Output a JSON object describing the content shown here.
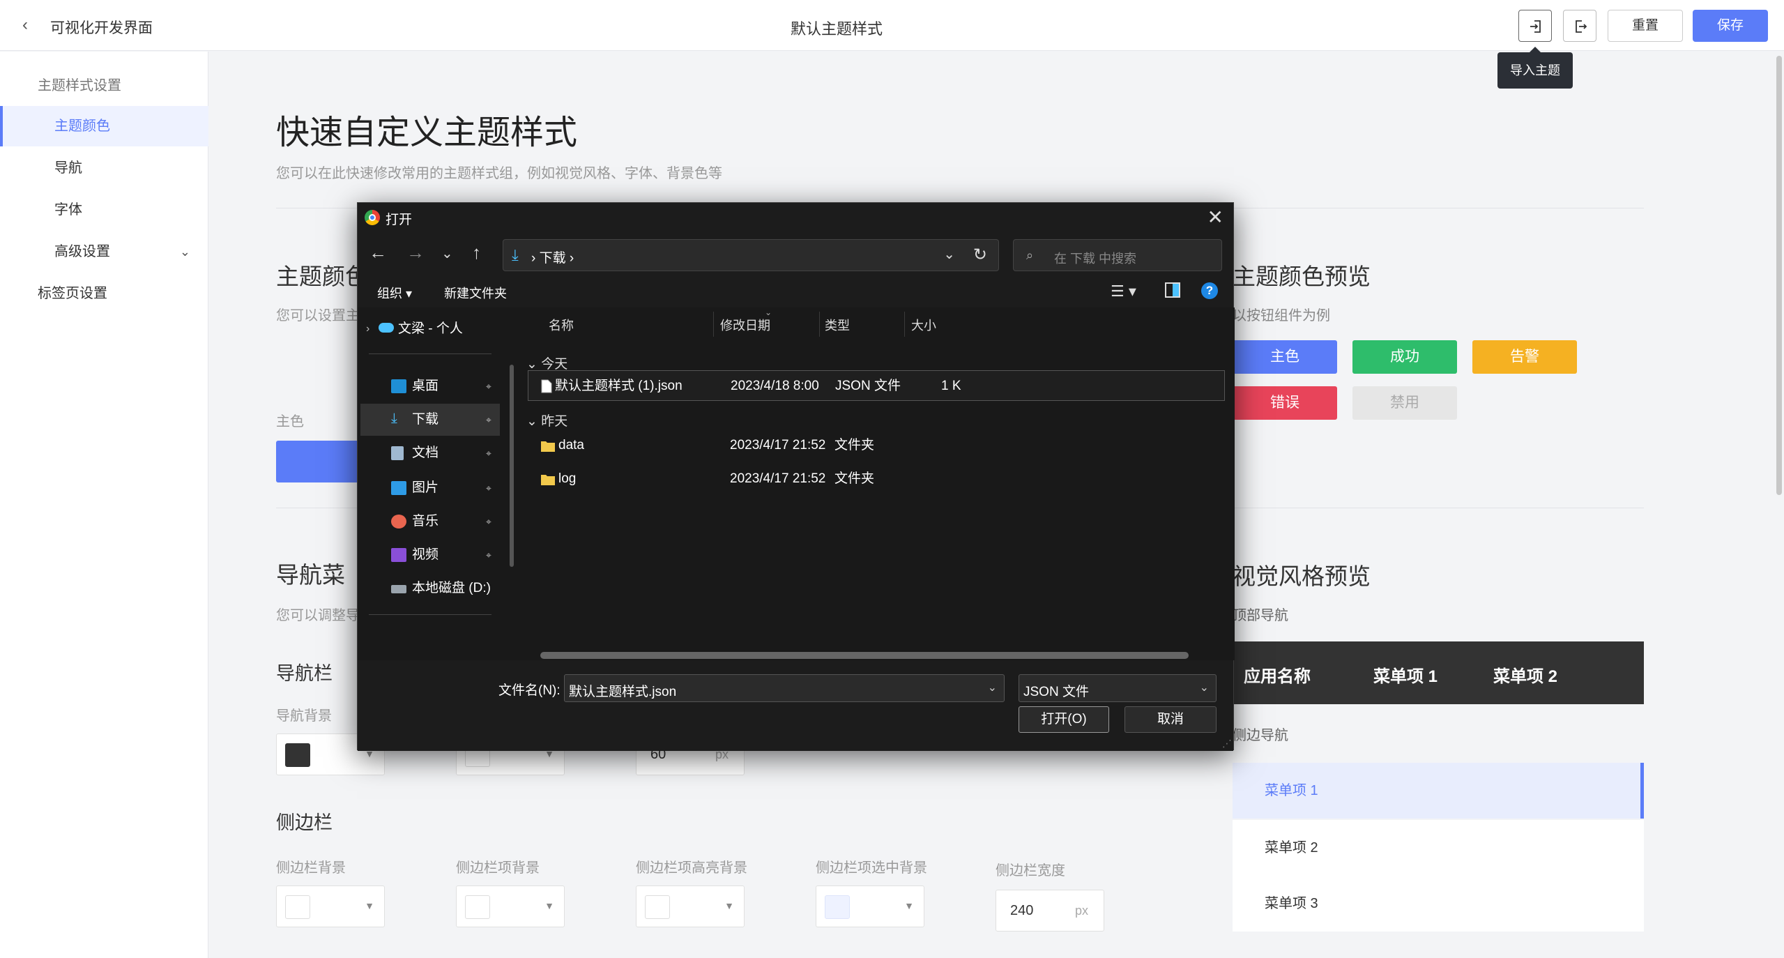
{
  "topbar": {
    "back_icon": "chevron-left-icon",
    "app_title": "可视化开发界面",
    "page_title": "默认主题样式",
    "import_icon": "login-icon",
    "export_icon": "logout-icon",
    "reset_label": "重置",
    "save_label": "保存",
    "tooltip": "导入主题"
  },
  "sidebar": {
    "group1": "主题样式设置",
    "items": [
      {
        "label": "主题颜色",
        "active": true
      },
      {
        "label": "导航"
      },
      {
        "label": "字体"
      },
      {
        "label": "高级设置"
      }
    ],
    "group2": "标签页设置"
  },
  "main": {
    "title": "快速自定义主题样式",
    "desc": "您可以在此快速修改常用的主题样式组，例如视觉风格、字体、背景色等",
    "color_section": {
      "title": "主题颜色",
      "desc": "您可以设置主",
      "primary_label": "主色"
    },
    "color_preview": {
      "title": "主题颜色预览",
      "desc": "以按钮组件为例",
      "buttons": [
        {
          "label": "主色",
          "color": "#5b7cf8"
        },
        {
          "label": "成功",
          "color": "#2ebd6b"
        },
        {
          "label": "告警",
          "color": "#f5b122"
        },
        {
          "label": "错误",
          "color": "#e8445a"
        },
        {
          "label": "禁用",
          "color": "#e6e6e6"
        }
      ]
    },
    "nav_section": {
      "title": "导航菜",
      "desc": "您可以调整导"
    },
    "navbar": {
      "title": "导航栏",
      "bg_label": "导航背景",
      "bg_color": "#333333",
      "height_value": "60",
      "height_unit": "px"
    },
    "side": {
      "title": "侧边栏",
      "labels": [
        "侧边栏背景",
        "侧边栏项背景",
        "侧边栏项高亮背景",
        "侧边栏项选中背景",
        "侧边栏宽度"
      ],
      "colors": [
        "#ffffff",
        "#ffffff",
        "#ffffff",
        "#eef2ff"
      ],
      "width_value": "240",
      "width_unit": "px"
    },
    "style_preview": {
      "title": "视觉风格预览",
      "top_nav_label": "顶部导航",
      "top_nav_items": [
        "应用名称",
        "菜单项 1",
        "菜单项 2"
      ],
      "side_nav_label": "侧边导航",
      "side_nav_items": [
        "菜单项 1",
        "菜单项 2",
        "菜单项 3"
      ]
    }
  },
  "dialog": {
    "title": "打开",
    "path": "下载",
    "search_placeholder": "在 下载 中搜索",
    "organize": "组织",
    "new_folder": "新建文件夹",
    "tree": [
      {
        "label": "文梁 - 个人",
        "icon": "cloud-icon"
      },
      {
        "label": "桌面",
        "icon": "desktop-icon"
      },
      {
        "label": "下载",
        "icon": "download-icon",
        "selected": true
      },
      {
        "label": "文档",
        "icon": "document-icon"
      },
      {
        "label": "图片",
        "icon": "picture-icon"
      },
      {
        "label": "音乐",
        "icon": "music-icon"
      },
      {
        "label": "视频",
        "icon": "video-icon"
      },
      {
        "label": "本地磁盘 (D:)",
        "icon": "drive-icon"
      }
    ],
    "columns": [
      "名称",
      "修改日期",
      "类型",
      "大小"
    ],
    "groups": [
      {
        "label": "今天",
        "files": [
          {
            "name": "默认主题样式 (1).json",
            "date": "2023/4/18 8:00",
            "type": "JSON 文件",
            "size": "1 K",
            "icon": "file-icon"
          }
        ]
      },
      {
        "label": "昨天",
        "files": [
          {
            "name": "data",
            "date": "2023/4/17 21:52",
            "type": "文件夹",
            "icon": "folder-icon"
          },
          {
            "name": "log",
            "date": "2023/4/17 21:52",
            "type": "文件夹",
            "icon": "folder-icon"
          }
        ]
      }
    ],
    "filename_label": "文件名(N):",
    "filename_value": "默认主题样式.json",
    "filetype_value": "JSON 文件",
    "open_label": "打开(O)",
    "cancel_label": "取消"
  }
}
